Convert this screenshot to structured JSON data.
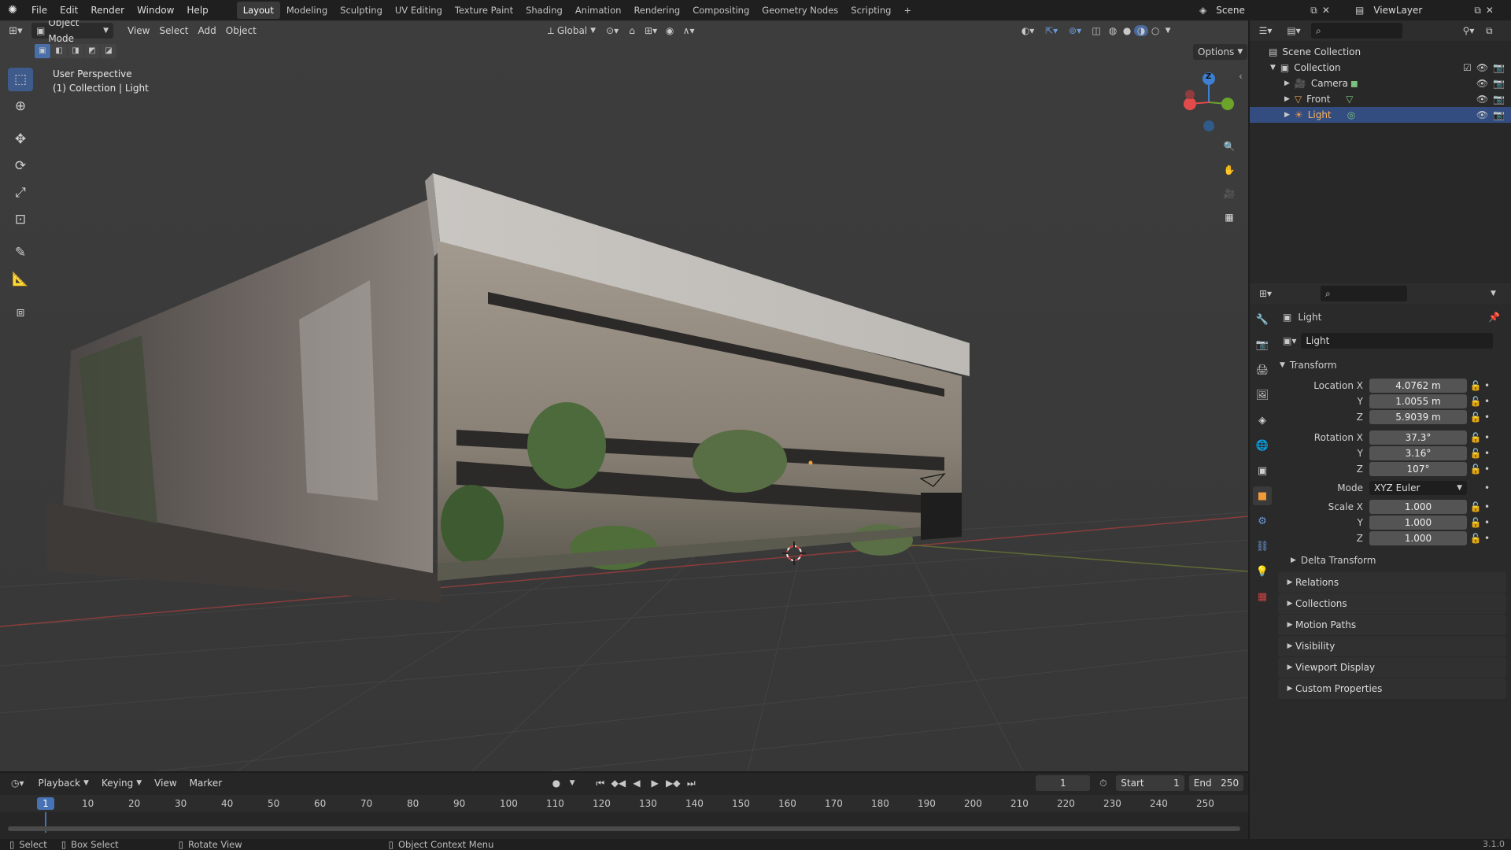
{
  "topbar": {
    "menus": [
      "File",
      "Edit",
      "Render",
      "Window",
      "Help"
    ],
    "workspaces": [
      "Layout",
      "Modeling",
      "Sculpting",
      "UV Editing",
      "Texture Paint",
      "Shading",
      "Animation",
      "Rendering",
      "Compositing",
      "Geometry Nodes",
      "Scripting"
    ],
    "active_workspace": "Layout",
    "add_tab": "+",
    "scene": "Scene",
    "view_layer": "ViewLayer"
  },
  "viewport": {
    "mode": "Object Mode",
    "menus": [
      "View",
      "Select",
      "Add",
      "Object"
    ],
    "orientation": "Global",
    "options_label": "Options",
    "overlay_title": "User Perspective",
    "overlay_sub": "(1) Collection | Light",
    "gizmo_axis": "Z",
    "tools": [
      "select-box",
      "cursor",
      "move",
      "rotate",
      "scale",
      "transform",
      "annotate",
      "measure",
      "add-cube"
    ]
  },
  "outliner": {
    "root": "Scene Collection",
    "collection": "Collection",
    "items": [
      {
        "name": "Camera",
        "selected": false
      },
      {
        "name": "Front",
        "selected": false
      },
      {
        "name": "Light",
        "selected": true
      }
    ]
  },
  "properties": {
    "object_name": "Light",
    "datablock_name": "Light",
    "transform_header": "Transform",
    "location_label": "Location X",
    "location": [
      "4.0762 m",
      "1.0055 m",
      "5.9039 m"
    ],
    "rotation_label": "Rotation X",
    "rotation": [
      "37.3°",
      "3.16°",
      "107°"
    ],
    "axis_y": "Y",
    "axis_z": "Z",
    "mode_label": "Mode",
    "mode_value": "XYZ Euler",
    "scale_label": "Scale X",
    "scale": [
      "1.000",
      "1.000",
      "1.000"
    ],
    "delta_transform": "Delta Transform",
    "sections": [
      "Relations",
      "Collections",
      "Motion Paths",
      "Visibility",
      "Viewport Display",
      "Custom Properties"
    ]
  },
  "timeline": {
    "menus": [
      "Playback",
      "Keying",
      "View",
      "Marker"
    ],
    "current_frame": "1",
    "start_label": "Start",
    "start": "1",
    "end_label": "End",
    "end": "250",
    "marker_frame": "1",
    "ticks": [
      "10",
      "20",
      "30",
      "40",
      "50",
      "60",
      "70",
      "80",
      "90",
      "100",
      "110",
      "120",
      "130",
      "140",
      "150",
      "160",
      "170",
      "180",
      "190",
      "200",
      "210",
      "220",
      "230",
      "240",
      "250"
    ]
  },
  "statusbar": {
    "items": [
      "Select",
      "Box Select",
      "Rotate View",
      "Object Context Menu"
    ],
    "version": "3.1.0"
  },
  "colors": {
    "accent": "#3f5b8c",
    "selection": "#334d80",
    "axis_x": "#e34a4a",
    "axis_y": "#6ca32b",
    "axis_z": "#3d7fd1"
  }
}
